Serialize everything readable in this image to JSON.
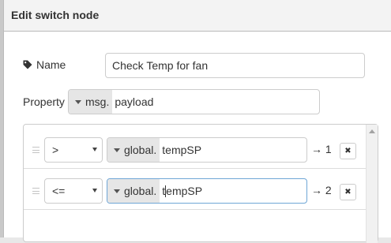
{
  "dialog": {
    "title": "Edit switch node"
  },
  "name_field": {
    "label": "Name",
    "value": "Check Temp for fan",
    "icon": "tag-icon"
  },
  "property_field": {
    "label": "Property",
    "type": "msg.",
    "value": "payload"
  },
  "rules": [
    {
      "operator": ">",
      "value_type": "global.",
      "value": "tempSP",
      "output": "→ 1",
      "delete_icon": "✖"
    },
    {
      "operator": "<=",
      "value_type": "global.",
      "value_before_cursor": "t",
      "value_after_cursor": "empSP",
      "output": "→ 2",
      "delete_icon": "✖"
    }
  ],
  "colors": {
    "focus_border": "#6fa6d6",
    "type_button_bg": "#e6e6e6",
    "header_bg": "#f3f3f3"
  }
}
